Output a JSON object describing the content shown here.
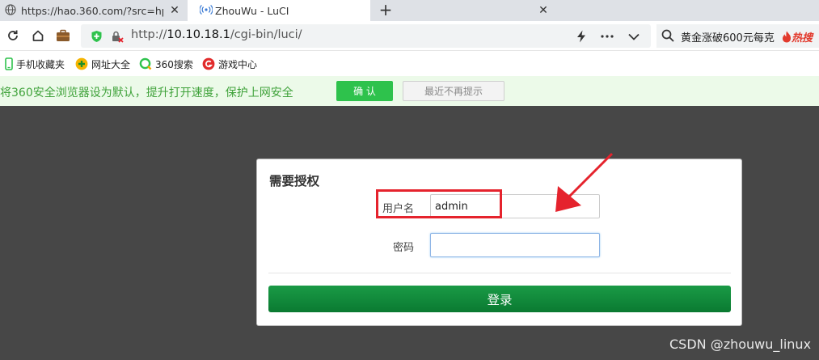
{
  "browser": {
    "tabs": [
      {
        "title": "https://hao.360.com/?src=hp",
        "icon": "globe-icon",
        "active": false
      },
      {
        "title": "ZhouWu - LuCI",
        "icon": "wifi-icon",
        "active": true
      }
    ],
    "address": {
      "prefix": "http://",
      "host": "10.10.18.1",
      "path": "/cgi-bin/luci/"
    },
    "search": {
      "text": "黄金涨破600元每克",
      "hot_label": "热搜"
    },
    "bookmarks": [
      {
        "label": "手机收藏夹",
        "icon": "phone-icon"
      },
      {
        "label": "网址大全",
        "icon": "nav-icon"
      },
      {
        "label": "360搜索",
        "icon": "360-search-icon"
      },
      {
        "label": "游戏中心",
        "icon": "game-icon"
      }
    ]
  },
  "notice": {
    "text": "将360安全浏览器设为默认，提升打开速度，保护上网安全",
    "confirm_label": "确 认",
    "dismiss_label": "最近不再提示"
  },
  "login": {
    "title": "需要授权",
    "username_label": "用户名",
    "username_value": "admin",
    "password_label": "密码",
    "password_value": "",
    "submit_label": "登录"
  },
  "watermark": "CSDN @zhouwu_linux",
  "colors": {
    "accent_green": "#0a7a31",
    "annotation_red": "#e5232d",
    "notice_text": "#3fa23a",
    "page_background": "#474747"
  }
}
